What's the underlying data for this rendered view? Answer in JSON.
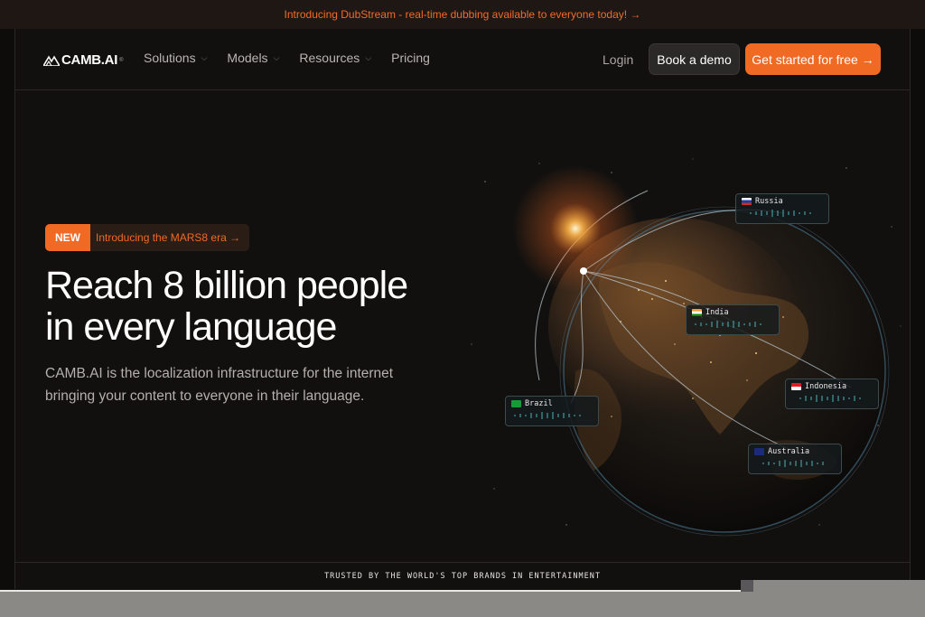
{
  "announcement": "Introducing DubStream - real-time dubbing available to everyone today! →",
  "nav": {
    "logo": "CAMB.AI",
    "logo_mark": "®",
    "items": [
      {
        "label": "Solutions",
        "has_dropdown": true
      },
      {
        "label": "Models",
        "has_dropdown": true
      },
      {
        "label": "Resources",
        "has_dropdown": true
      },
      {
        "label": "Pricing",
        "has_dropdown": false
      }
    ],
    "login": "Login",
    "demo": "Book a demo",
    "cta": "Get started for free →"
  },
  "hero": {
    "badge_new": "NEW",
    "badge_text": "Introducing the MARS8 era →",
    "headline_line1": "Reach 8 billion people",
    "headline_line2": "in every language",
    "subtext": "CAMB.AI is the localization infrastructure for the internet bringing your content to everyone in their language."
  },
  "globe_tags": [
    {
      "name": "Russia"
    },
    {
      "name": "India"
    },
    {
      "name": "Indonesia"
    },
    {
      "name": "Brazil"
    },
    {
      "name": "Australia"
    }
  ],
  "trusted": "TRUSTED BY THE WORLD'S TOP BRANDS IN ENTERTAINMENT",
  "colors": {
    "accent": "#f06a24",
    "background": "#11100f",
    "wave": "#4fb3b8"
  }
}
